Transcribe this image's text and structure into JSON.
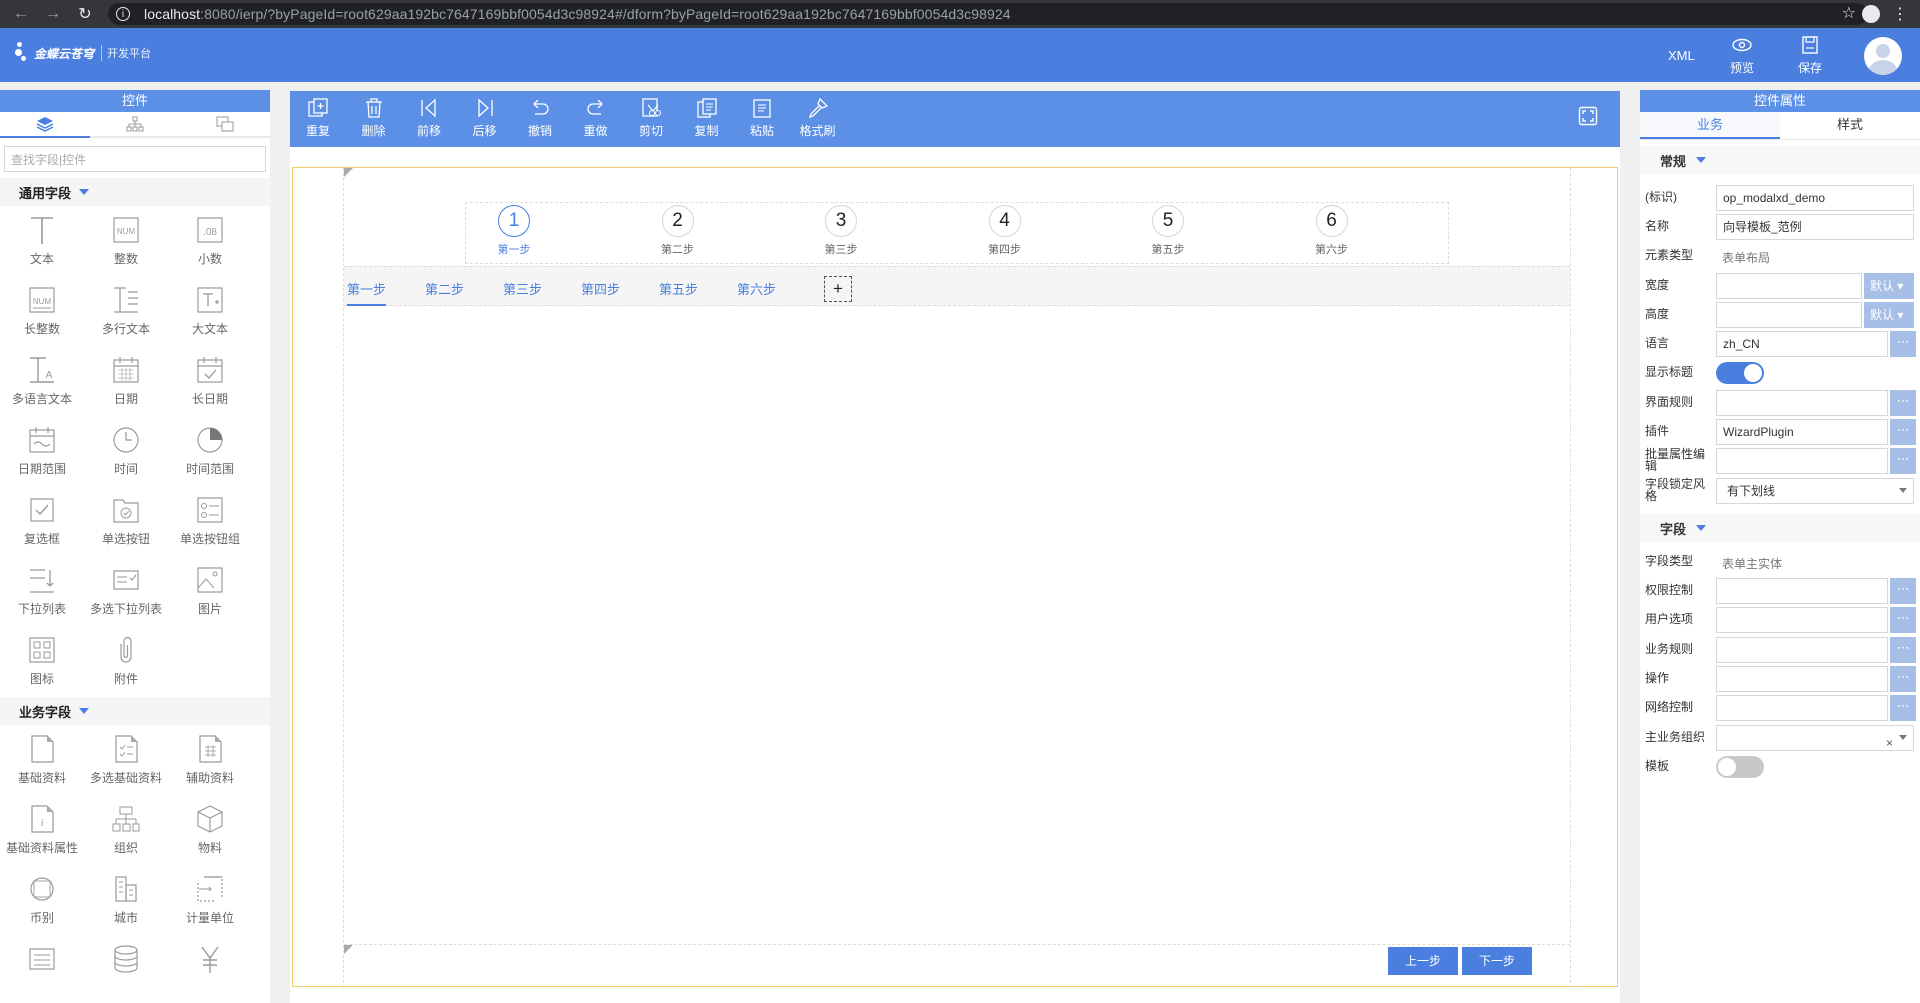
{
  "browser": {
    "url_host": "localhost",
    "url_rest": ":8080/ierp/?byPageId=root629aa192bc7647169bbf0054d3c98924#/dform?byPageId=root629aa192bc7647169bbf0054d3c98924"
  },
  "header": {
    "logo_text": "金蝶云苍穹",
    "logo_sub": "开发平台",
    "xml_label": "XML",
    "preview_label": "预览",
    "save_label": "保存",
    "colors": {
      "bar": "#4a7fe0",
      "accent": "#5b90e6"
    }
  },
  "left_panel": {
    "title": "控件",
    "tab_icons": [
      "layers-icon",
      "tree-icon",
      "components-icon"
    ],
    "search_placeholder": "查找字段|控件",
    "groups": [
      {
        "title": "通用字段",
        "items": [
          {
            "label": "文本",
            "icon": "text-field-icon"
          },
          {
            "label": "整数",
            "icon": "integer-icon"
          },
          {
            "label": "小数",
            "icon": "decimal-icon"
          },
          {
            "label": "长整数",
            "icon": "long-integer-icon"
          },
          {
            "label": "多行文本",
            "icon": "multiline-text-icon"
          },
          {
            "label": "大文本",
            "icon": "large-text-icon"
          },
          {
            "label": "多语言文本",
            "icon": "multilang-text-icon"
          },
          {
            "label": "日期",
            "icon": "date-icon"
          },
          {
            "label": "长日期",
            "icon": "long-date-icon"
          },
          {
            "label": "日期范围",
            "icon": "date-range-icon"
          },
          {
            "label": "时间",
            "icon": "time-icon"
          },
          {
            "label": "时间范围",
            "icon": "time-range-icon"
          },
          {
            "label": "复选框",
            "icon": "checkbox-icon"
          },
          {
            "label": "单选按钮",
            "icon": "radio-icon"
          },
          {
            "label": "单选按钮组",
            "icon": "radio-group-icon"
          },
          {
            "label": "下拉列表",
            "icon": "dropdown-icon"
          },
          {
            "label": "多选下拉列表",
            "icon": "multi-dropdown-icon"
          },
          {
            "label": "图片",
            "icon": "image-icon"
          },
          {
            "label": "图标",
            "icon": "icon-grid-icon"
          },
          {
            "label": "附件",
            "icon": "attachment-icon"
          }
        ]
      },
      {
        "title": "业务字段",
        "items": [
          {
            "label": "基础资料",
            "icon": "basedata-icon"
          },
          {
            "label": "多选基础资料",
            "icon": "multi-basedata-icon"
          },
          {
            "label": "辅助资料",
            "icon": "assist-data-icon"
          },
          {
            "label": "基础资料属性",
            "icon": "basedata-prop-icon"
          },
          {
            "label": "组织",
            "icon": "org-icon"
          },
          {
            "label": "物料",
            "icon": "material-icon"
          },
          {
            "label": "币别",
            "icon": "currency-icon"
          },
          {
            "label": "城市",
            "icon": "city-icon"
          },
          {
            "label": "计量单位",
            "icon": "unit-icon"
          },
          {
            "label": "",
            "icon": "list-icon"
          },
          {
            "label": "",
            "icon": "database-icon"
          },
          {
            "label": "",
            "icon": "yuan-icon"
          }
        ]
      }
    ]
  },
  "toolbar": {
    "items": [
      {
        "label": "重复",
        "icon": "duplicate-icon"
      },
      {
        "label": "删除",
        "icon": "delete-icon"
      },
      {
        "label": "前移",
        "icon": "move-before-icon"
      },
      {
        "label": "后移",
        "icon": "move-after-icon"
      },
      {
        "label": "撤销",
        "icon": "undo-icon"
      },
      {
        "label": "重做",
        "icon": "redo-icon"
      },
      {
        "label": "剪切",
        "icon": "cut-icon"
      },
      {
        "label": "复制",
        "icon": "copy-icon"
      },
      {
        "label": "粘贴",
        "icon": "paste-icon"
      },
      {
        "label": "格式刷",
        "icon": "format-brush-icon"
      }
    ]
  },
  "wizard": {
    "steps": [
      {
        "num": "1",
        "label": "第一步"
      },
      {
        "num": "2",
        "label": "第二步"
      },
      {
        "num": "3",
        "label": "第三步"
      },
      {
        "num": "4",
        "label": "第四步"
      },
      {
        "num": "5",
        "label": "第五步"
      },
      {
        "num": "6",
        "label": "第六步"
      }
    ],
    "active_step": 1,
    "tabs": [
      "第一步",
      "第二步",
      "第三步",
      "第四步",
      "第五步",
      "第六步"
    ],
    "add_tab": "+",
    "prev_button": "上一步",
    "next_button": "下一步"
  },
  "right_panel": {
    "title": "控件属性",
    "tabs": [
      "业务",
      "样式"
    ],
    "section_general": "常规",
    "section_field": "字段",
    "props": {
      "key_label": "(标识)",
      "key_value": "op_modalxd_demo",
      "name_label": "名称",
      "name_value": "向导模板_范例",
      "elem_type_label": "元素类型",
      "elem_type_value": "表单布局",
      "width_label": "宽度",
      "width_default": "默认",
      "height_label": "高度",
      "height_default": "默认",
      "lang_label": "语言",
      "lang_value": "zh_CN",
      "show_title_label": "显示标题",
      "ui_rule_label": "界面规则",
      "plugin_label": "插件",
      "plugin_value": "WizardPlugin",
      "batch_label": "批量属性编辑",
      "lock_style_label": "字段锁定风格",
      "lock_style_value": "有下划线",
      "field_type_label": "字段类型",
      "field_type_value": "表单主实体",
      "perm_label": "权限控制",
      "user_opt_label": "用户选项",
      "biz_rule_label": "业务规则",
      "op_label": "操作",
      "net_label": "网络控制",
      "main_org_label": "主业务组织",
      "template_label": "模板"
    },
    "show_title_on": true,
    "template_on": false
  }
}
